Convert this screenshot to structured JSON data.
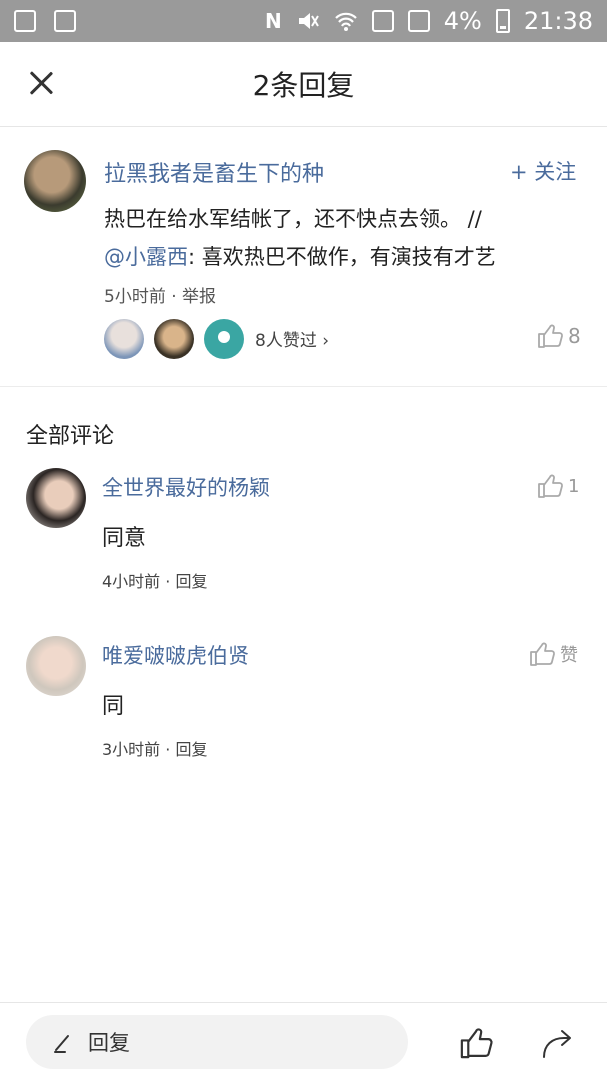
{
  "status_bar": {
    "battery_percent": "4%",
    "time": "21:38",
    "icons": [
      "notification-icon",
      "image-icon",
      "nfc-icon",
      "mute-icon",
      "wifi-icon",
      "sim1-icon",
      "sim2-icon",
      "battery-icon"
    ]
  },
  "header": {
    "title": "2条回复",
    "close_icon": "close-icon"
  },
  "main_post": {
    "author": "拉黑我者是畜生下的种",
    "follow_label": "+ 关注",
    "text_part1": "热巴在给水军结帐了，还不快点去领。 //",
    "mention": "@小露西",
    "text_part2": ": 喜欢热巴不做作，有演技有才艺",
    "meta": "5小时前 · 举报",
    "likers_text": "8人赞过 ›",
    "like_count": "8"
  },
  "comments_section": {
    "title": "全部评论",
    "items": [
      {
        "name": "全世界最好的杨颖",
        "text": "同意",
        "meta": "4小时前 · 回复",
        "like": "1"
      },
      {
        "name": "唯爱啵啵虎伯贤",
        "text": "同",
        "meta": "3小时前 · 回复",
        "like": "赞"
      }
    ]
  },
  "bottom_bar": {
    "reply_label": "回复",
    "icons": [
      "edit-icon",
      "thumbs-up-icon",
      "share-icon"
    ]
  },
  "colors": {
    "link_blue": "#4a6b9c",
    "status_bar": "#9a9a9a",
    "reply_box_bg": "#f2f2f2"
  }
}
